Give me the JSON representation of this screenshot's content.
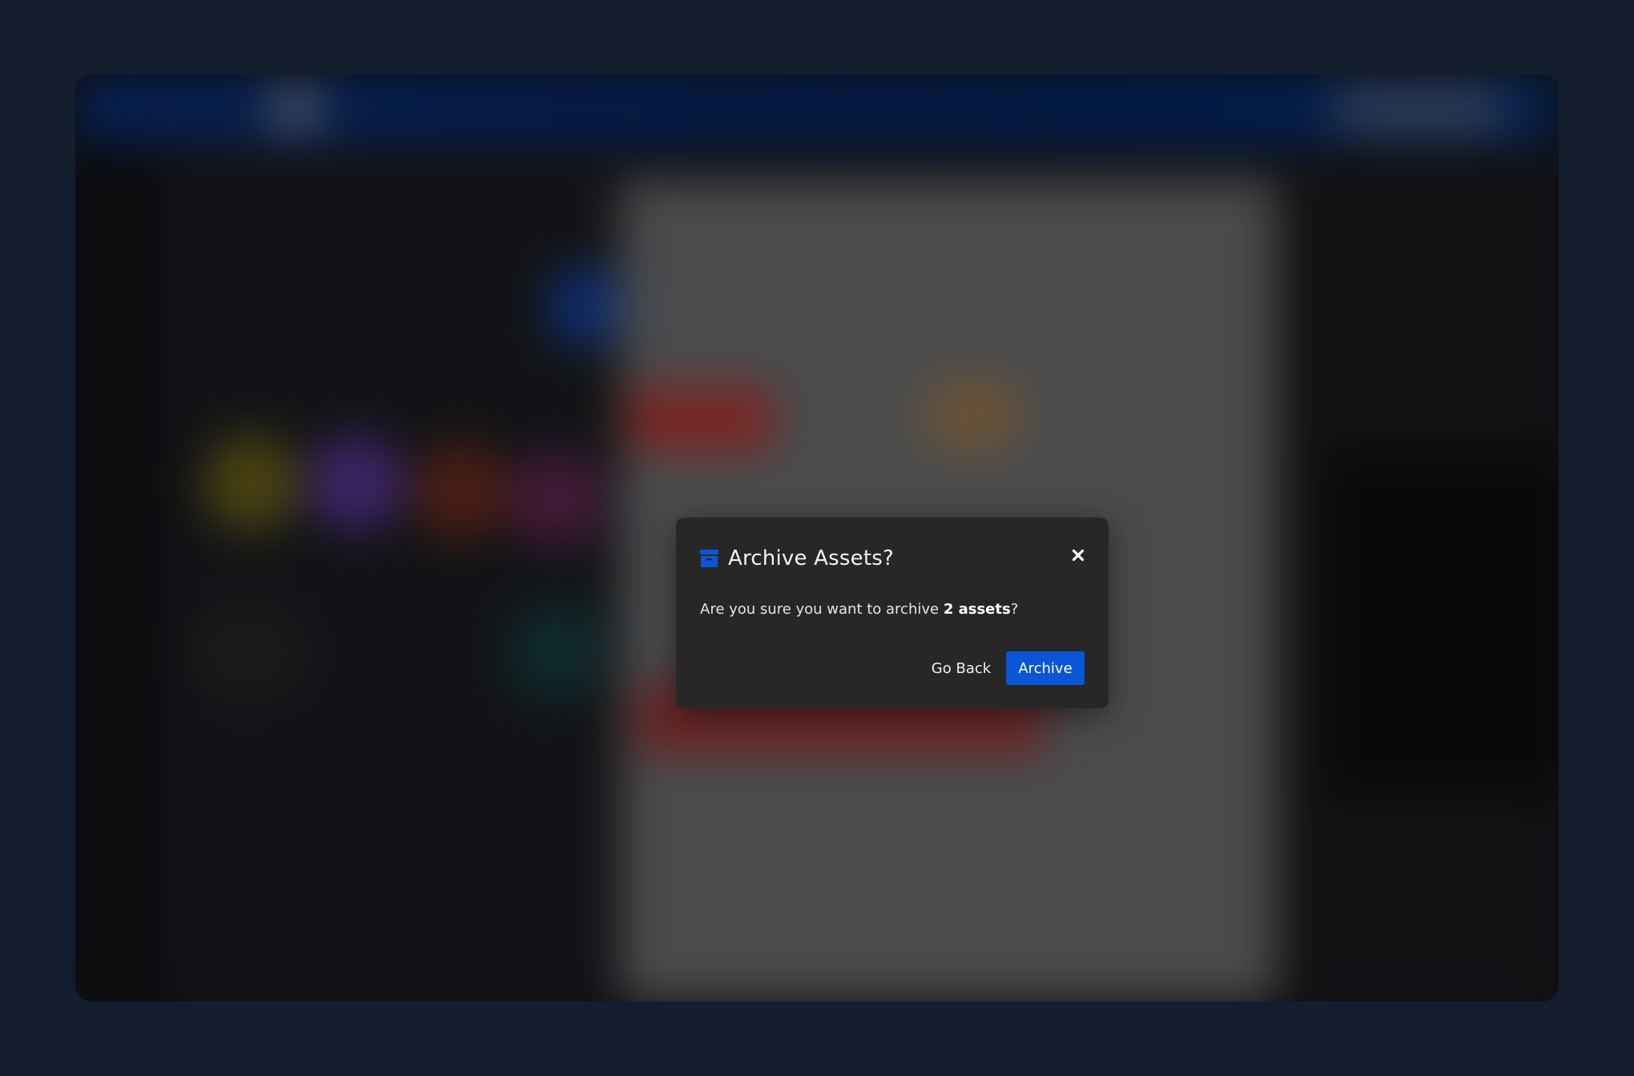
{
  "modal": {
    "title": "Archive Assets?",
    "icon": "archive-icon",
    "message_prefix": "Are you sure you want to archive ",
    "message_bold": "2 assets",
    "message_suffix": "?",
    "buttons": {
      "go_back": "Go Back",
      "archive": "Archive"
    },
    "close_icon": "close-icon"
  },
  "colors": {
    "accent": "#0A56D6",
    "modal_bg": "#272727",
    "frame": "#141D2E",
    "backdrop": "#0F1013"
  }
}
